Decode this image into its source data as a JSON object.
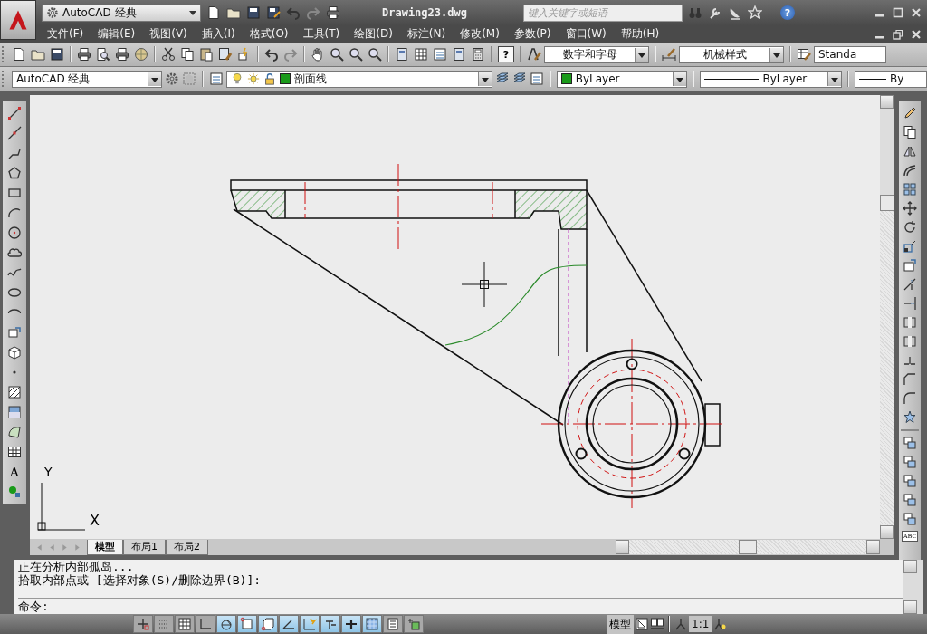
{
  "title_bar": {
    "workspace": "AutoCAD 经典",
    "title": "Drawing23.dwg",
    "search": {
      "placeholder": "键入关键字或短语"
    },
    "help": "?"
  },
  "menu": [
    "文件(F)",
    "编辑(E)",
    "视图(V)",
    "插入(I)",
    "格式(O)",
    "工具(T)",
    "绘图(D)",
    "标注(N)",
    "修改(M)",
    "参数(P)",
    "窗口(W)",
    "帮助(H)"
  ],
  "standard_toolbar": {
    "help": "?",
    "text_style": "数字和字母",
    "dim_style": "机械样式",
    "table_style": "Standa"
  },
  "layers_toolbar": {
    "workspace": "AutoCAD 经典",
    "layer": {
      "name": "剖面线",
      "color": "#1a9a1a"
    },
    "color": {
      "name": "ByLayer",
      "color": "#1a9a1a"
    },
    "linetype": "ByLayer",
    "lineweight": "By"
  },
  "draw_toolbar": {
    "text_tool": "A"
  },
  "modify_toolbar": {
    "spell_tool": "ABC"
  },
  "ucs": {
    "x": "X",
    "y": "Y"
  },
  "layout_tabs": [
    {
      "label": "模型",
      "selected": true
    },
    {
      "label": "布局1",
      "selected": false
    },
    {
      "label": "布局2",
      "selected": false
    }
  ],
  "command": {
    "history": [
      "正在分析内部孤岛...",
      "拾取内部点或 [选择对象(S)/删除边界(B)]:"
    ],
    "prompt": "命令:"
  },
  "status_toggles": [
    {
      "on": false
    },
    {
      "on": false
    },
    {
      "on": false
    },
    {
      "on": false
    },
    {
      "on": true
    },
    {
      "on": true
    },
    {
      "on": true
    },
    {
      "on": true
    },
    {
      "on": true
    },
    {
      "on": true
    },
    {
      "on": true
    },
    {
      "on": true
    },
    {
      "on": false
    },
    {
      "on": false
    }
  ],
  "status_bar": {
    "space": "模型",
    "annotation_scale": "1:1"
  }
}
